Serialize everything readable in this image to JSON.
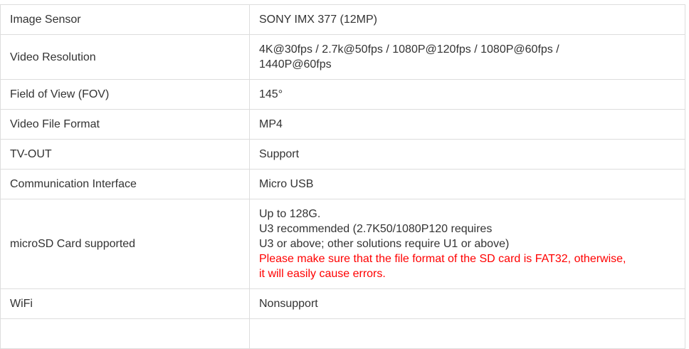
{
  "specs": {
    "rows": [
      {
        "label": "Image Sensor",
        "value": "SONY IMX 377 (12MP)"
      },
      {
        "label": "Video Resolution",
        "value_lines": [
          "4K@30fps / 2.7k@50fps / 1080P@120fps / 1080P@60fps /",
          "1440P@60fps"
        ]
      },
      {
        "label": "Field of View (FOV)",
        "value": "145°"
      },
      {
        "label": "Video File Format",
        "value": "MP4"
      },
      {
        "label": "TV-OUT",
        "value": "Support"
      },
      {
        "label": "Communication Interface",
        "value": "Micro USB"
      },
      {
        "label": "microSD Card supported",
        "value_lines": [
          "Up to 128G.",
          "U3 recommended (2.7K50/1080P120 requires",
          "U3 or above; other solutions require U1 or above)"
        ],
        "warning_lines": [
          "Please make sure that the file format of the SD card is FAT32, otherwise,",
          "it will easily cause errors."
        ],
        "warning_color": "#ff0000"
      },
      {
        "label": "WiFi",
        "value": "Nonsupport"
      },
      {
        "label": "",
        "value": ""
      }
    ]
  }
}
